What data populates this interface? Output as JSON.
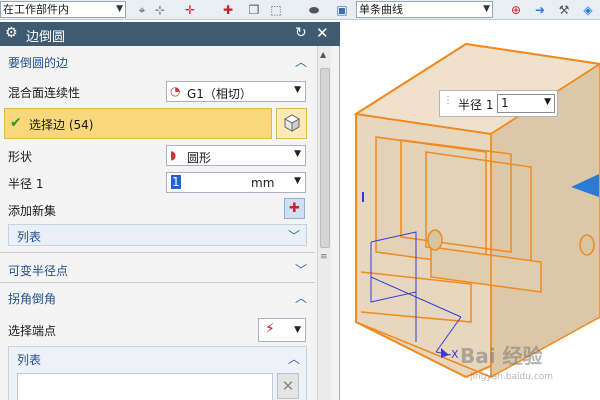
{
  "toolbar": {
    "scope_select": "在工作部件内",
    "curve_rule_select": "单条曲线"
  },
  "dialog": {
    "title": "边倒圆",
    "sections": {
      "edges": {
        "title": "要倒圆的边",
        "blend_continuity_label": "混合面连续性",
        "blend_continuity_value": "G1（相切）",
        "select_edge_label": "选择边 (54)",
        "shape_label": "形状",
        "shape_value": "圆形",
        "radius_label": "半径 1",
        "radius_value": "1",
        "radius_unit": "mm",
        "add_new_set_label": "添加新集",
        "list_label": "列表"
      },
      "variable_radius": {
        "title": "可变半径点"
      },
      "corner_setback": {
        "title": "拐角倒角",
        "select_endpoint_label": "选择端点",
        "list_label": "列表"
      }
    }
  },
  "viewport": {
    "radius_label": "半径 1",
    "radius_value": "1",
    "axis_x": "X"
  },
  "watermark": {
    "text": "Bai 经验",
    "sub": "jingyan.baidu.com"
  }
}
